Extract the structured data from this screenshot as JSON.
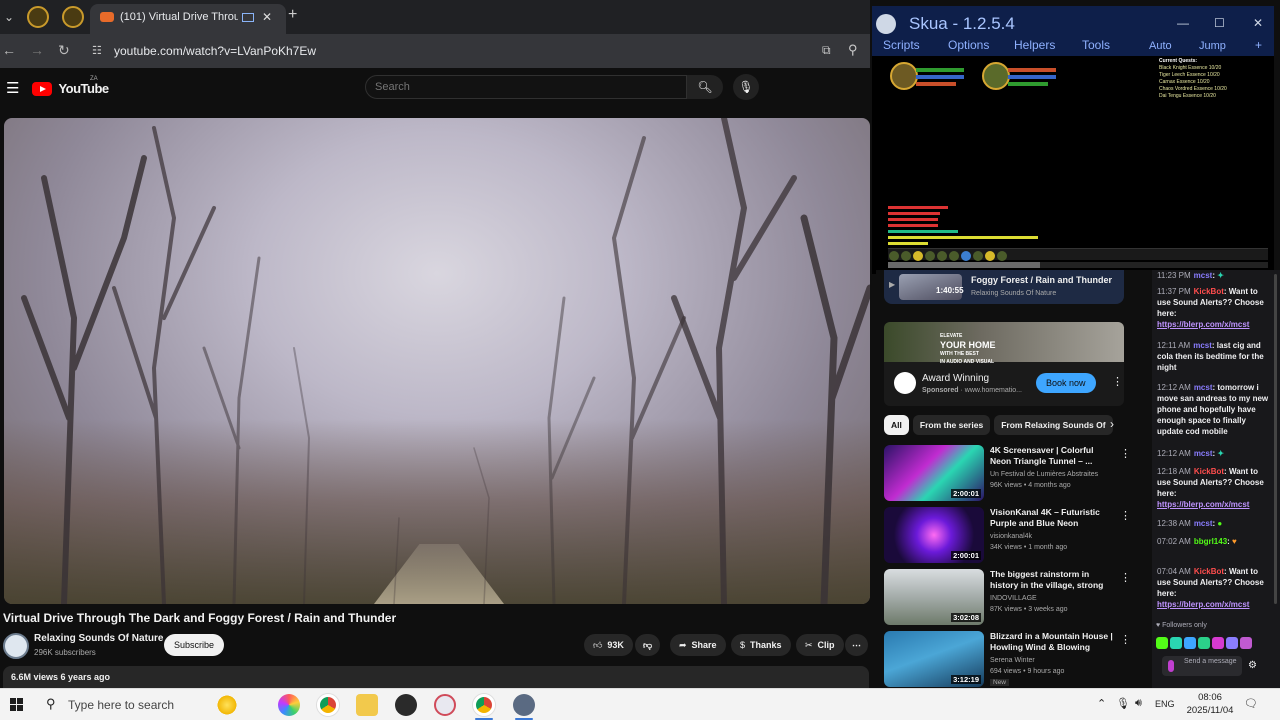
{
  "browser": {
    "active_tab_title": "(101) Virtual Drive Through",
    "url": "youtube.com/watch?v=LVanPoKh7Ew"
  },
  "youtube": {
    "logo_text": "YouTube",
    "country": "ZA",
    "search_placeholder": "Search",
    "video_title": "Virtual Drive Through The Dark and Foggy Forest / Rain and Thunder",
    "channel_name": "Relaxing Sounds Of Nature",
    "subscribers": "296K subscribers",
    "subscribe_label": "Subscribe",
    "actions": {
      "likes": "93K",
      "share": "Share",
      "thanks": "Thanks",
      "clip": "Clip"
    },
    "description_meta": "6.6M views  6 years ago"
  },
  "skua": {
    "title": "Skua - 1.2.5.4",
    "menu": [
      "Scripts",
      "Options",
      "Helpers",
      "Tools"
    ],
    "right_menu": [
      "Auto",
      "Jump"
    ],
    "quest_header": "Current Quests:",
    "quests": [
      "Black Knight Essence 10/20",
      "Tiger Leech Essence 10/20",
      "Carnax Essence 10/20",
      "Chaos Vordred Essence 10/20",
      "Dai Tengu Essence 10/20"
    ]
  },
  "sidebar": {
    "now_playing": {
      "title": "Foggy Forest / Rain and Thunder",
      "channel": "Relaxing Sounds Of Nature",
      "duration": "1:40:55"
    },
    "ad": {
      "banner_text_1": "ELEVATE",
      "banner_text_2": "YOUR HOME",
      "banner_text_3": "WITH THE BEST",
      "banner_text_4": "IN AUDIO AND VISUAL",
      "title": "Award Winning",
      "sponsored": "Sponsored",
      "domain": "www.homematio...",
      "button": "Book now"
    },
    "chips": [
      "All",
      "From the series",
      "From Relaxing Sounds Of"
    ],
    "recs": [
      {
        "title": "4K Screensaver | Colorful Neon Triangle Tunnel – ...",
        "channel": "Un Festival de Lumières Abstraites",
        "meta": "96K views • 4 months ago",
        "duration": "2:00:01",
        "new": ""
      },
      {
        "title": "VisionKanal 4K – Futuristic Purple and Blue Neon Triangle...",
        "channel": "visionkanal4k",
        "meta": "34K views • 1 month ago",
        "duration": "2:00:01",
        "new": ""
      },
      {
        "title": "The biggest rainstorm in history in the village, strong winds hit ...",
        "channel": "INDOVILLAGE",
        "meta": "87K views • 3 weeks ago",
        "duration": "3:02:08",
        "new": ""
      },
      {
        "title": "Blizzard in a Mountain House | Howling Wind & Blowing Snow...",
        "channel": "Serena Winter",
        "meta": "694 views • 9 hours ago",
        "duration": "3:12:19",
        "new": "New"
      }
    ]
  },
  "chat": {
    "messages": [
      {
        "ts": "11:23 PM",
        "user": "mcst",
        "text": "",
        "color": "#8a7dff"
      },
      {
        "ts": "11:37 PM",
        "user": "KickBot",
        "text": "Want to use Sound Alerts?? Choose here: ",
        "link": "https://blerp.com/x/mcst",
        "color": "#ff4d4d"
      },
      {
        "ts": "12:11 AM",
        "user": "mcst",
        "text": "last cig and cola then its bedtime for the night",
        "color": "#8a7dff"
      },
      {
        "ts": "12:12 AM",
        "user": "mcst",
        "text": "tomorrow i move san andreas to my new phone and hopefully have enough space to finally update cod mobile",
        "color": "#8a7dff"
      },
      {
        "ts": "12:12 AM",
        "user": "mcst",
        "text": "",
        "color": "#8a7dff"
      },
      {
        "ts": "12:18 AM",
        "user": "KickBot",
        "text": "Want to use Sound Alerts?? Choose here: ",
        "link": "https://blerp.com/x/mcst",
        "color": "#ff4d4d"
      },
      {
        "ts": "12:38 AM",
        "user": "mcst",
        "text": "",
        "color": "#8a7dff"
      },
      {
        "ts": "07:02 AM",
        "user": "bbgrl143",
        "text": "",
        "color": "#53fc18"
      },
      {
        "ts": "07:04 AM",
        "user": "KickBot",
        "text": "Want to use Sound Alerts?? Choose here: ",
        "link": "https://blerp.com/x/mcst",
        "color": "#ff4d4d"
      }
    ],
    "followers_only": "Followers only",
    "input_placeholder": "Send a message"
  },
  "taskbar": {
    "search_placeholder": "Type here to search",
    "language": "ENG",
    "time": "08:06",
    "date": "2025/11/04"
  },
  "colors": {
    "yt_red": "#ff0000",
    "skua_blue": "#0e1f4a",
    "kick_green": "#53fc18",
    "chat_bg": "#18181b"
  }
}
